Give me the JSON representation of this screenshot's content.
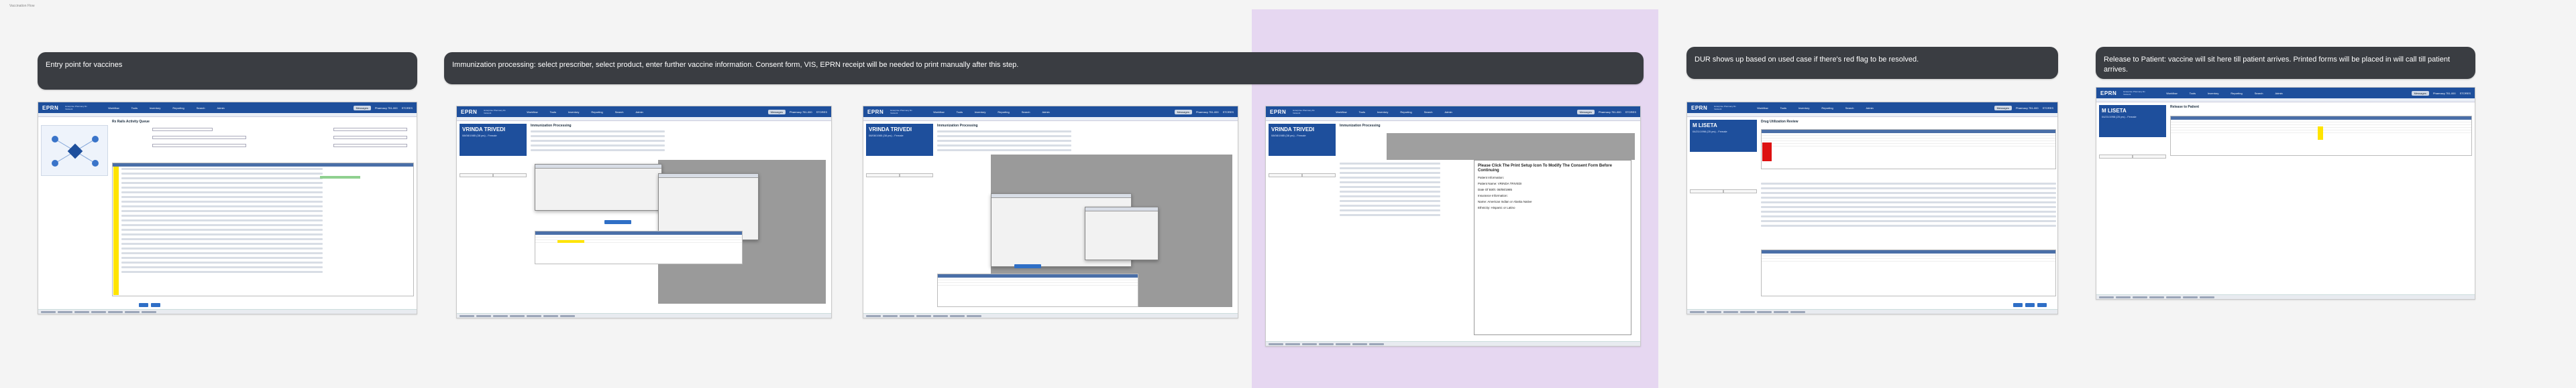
{
  "page": {
    "top_label": "Vaccination Flow"
  },
  "callouts": [
    {
      "id": "entry",
      "text": "Entry point for vaccines"
    },
    {
      "id": "immunization",
      "text": "Immunization processing: select prescriber, select product, enter further vaccine information. Consent form, VIS, EPRN receipt will be needed to print manually after this step."
    },
    {
      "id": "dur",
      "text": "DUR shows up based on used case if there's red flag to be resolved."
    },
    {
      "id": "release",
      "text": "Release to Patient: vaccine will sit here till patient arrives. Printed forms will be placed in will call till patient arrives."
    }
  ],
  "app": {
    "logo": "EPRN",
    "logo_sub": "Enterprise Pharmacy Rx Network",
    "menu": [
      "Workflow",
      "Tools",
      "Inventory",
      "Reporting",
      "Search",
      "Admin"
    ],
    "right": [
      "Pharmacy 751-000",
      "STORES"
    ],
    "pill": "Messages"
  },
  "screens": [
    {
      "id": "s1",
      "title": "Rx Rails Activity Queue"
    },
    {
      "id": "s2",
      "title": "Immunization Processing",
      "patient": "VRINDA TRIVEDI",
      "info": "08/08/1985 (38 yrs) - Female"
    },
    {
      "id": "s3",
      "title": "Immunization Processing",
      "patient": "VRINDA TRIVEDI",
      "info": "08/08/1985 (38 yrs) - Female"
    },
    {
      "id": "s4",
      "title": "Immunization Processing",
      "patient": "VRINDA TRIVEDI",
      "info": "08/08/1985 (38 yrs) - Female",
      "doc": {
        "title": "Please Click The Print Setup Icon To Modify The Consent Form Before Continuing",
        "lines": [
          "Patient Information:",
          "Patient Name: VRINDA TRIVEDI",
          "Date Of Birth: 08/08/1985",
          "Insurance Information:",
          "Name: American Indian or Alaska Native",
          "Ethnicity: Hispanic or Latino"
        ]
      }
    },
    {
      "id": "s5",
      "title": "Drug Utilization Review",
      "patient": "M LISETA",
      "info": "04/21/1998 (25 yrs) - Female"
    },
    {
      "id": "s6",
      "title": "Release to Patient",
      "patient": "M LISETA",
      "info": "04/21/1998 (25 yrs) - Female"
    }
  ]
}
